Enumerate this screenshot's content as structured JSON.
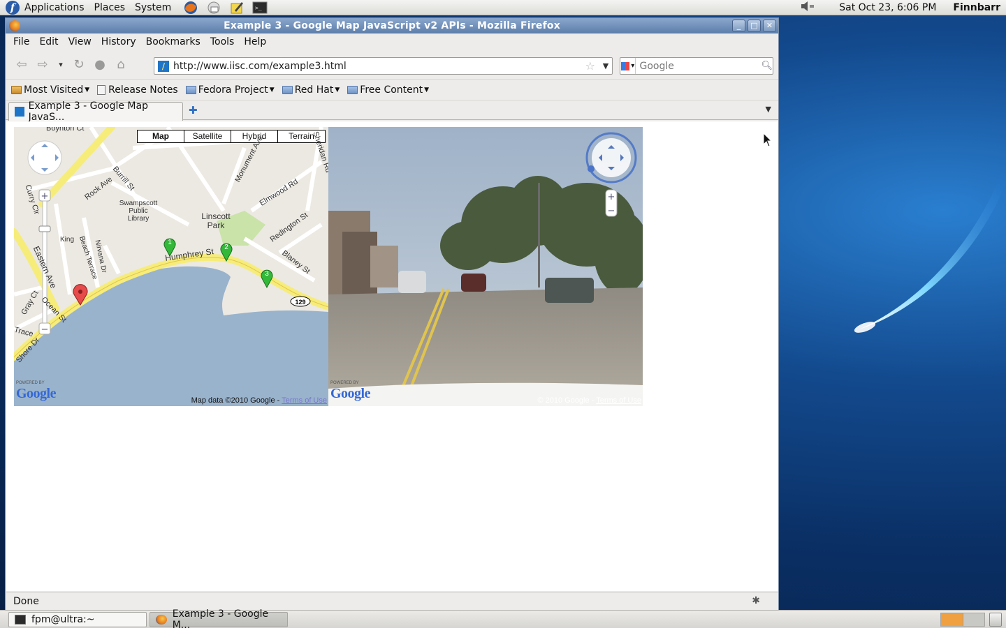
{
  "top_panel": {
    "menus": [
      "Applications",
      "Places",
      "System"
    ],
    "clock": "Sat Oct 23,  6:06 PM",
    "user": "Finnbarr"
  },
  "window": {
    "title": "Example 3 - Google Map JavaScript v2 APIs - Mozilla Firefox"
  },
  "menubar": [
    "File",
    "Edit",
    "View",
    "History",
    "Bookmarks",
    "Tools",
    "Help"
  ],
  "navbar": {
    "url": "http://www.iisc.com/example3.html",
    "search_placeholder": "Google"
  },
  "bookmarks": [
    "Most Visited",
    "Release Notes",
    "Fedora Project",
    "Red Hat",
    "Free Content"
  ],
  "tab": {
    "title": "Example 3 - Google Map JavaS..."
  },
  "map": {
    "types": [
      "Map",
      "Satellite",
      "Hybrid",
      "Terrain"
    ],
    "active_type": "Map",
    "labels": {
      "boynton": "Boynton Ct",
      "rock_ave": "Rock Ave",
      "burrill": "Burrill St",
      "monument": "Monument Ave",
      "elmwood": "Elmwood Rd",
      "sheridan": "Sheridan Rd",
      "library": "Swampscott Public Library",
      "linscott": "Linscott Park",
      "redington": "Redington St",
      "humphrey": "Humphrey St",
      "blaney": "Blaney St",
      "curry": "Curry Cir",
      "king": "King",
      "beach": "Beach Terrace",
      "nirvana": "Nirvana Dr",
      "eastern": "Eastern Ave",
      "ocean": "Ocean St",
      "gray": "Gray Ct",
      "shore": "Shore Dr",
      "route": "129",
      "terrace": "Trace"
    },
    "markers": [
      "1",
      "2",
      "3"
    ],
    "powered_by": "POWERED BY",
    "logo": "Google",
    "footer_text": "Map data ©2010 Google - ",
    "terms": "Terms of Use"
  },
  "streetview": {
    "powered_by": "POWERED BY",
    "logo": "Google",
    "footer_text": "© 2010 Google - ",
    "terms": "Terms of Use"
  },
  "status": "Done",
  "taskbar": {
    "items": [
      "fpm@ultra:~",
      "Example 3 - Google M..."
    ]
  }
}
